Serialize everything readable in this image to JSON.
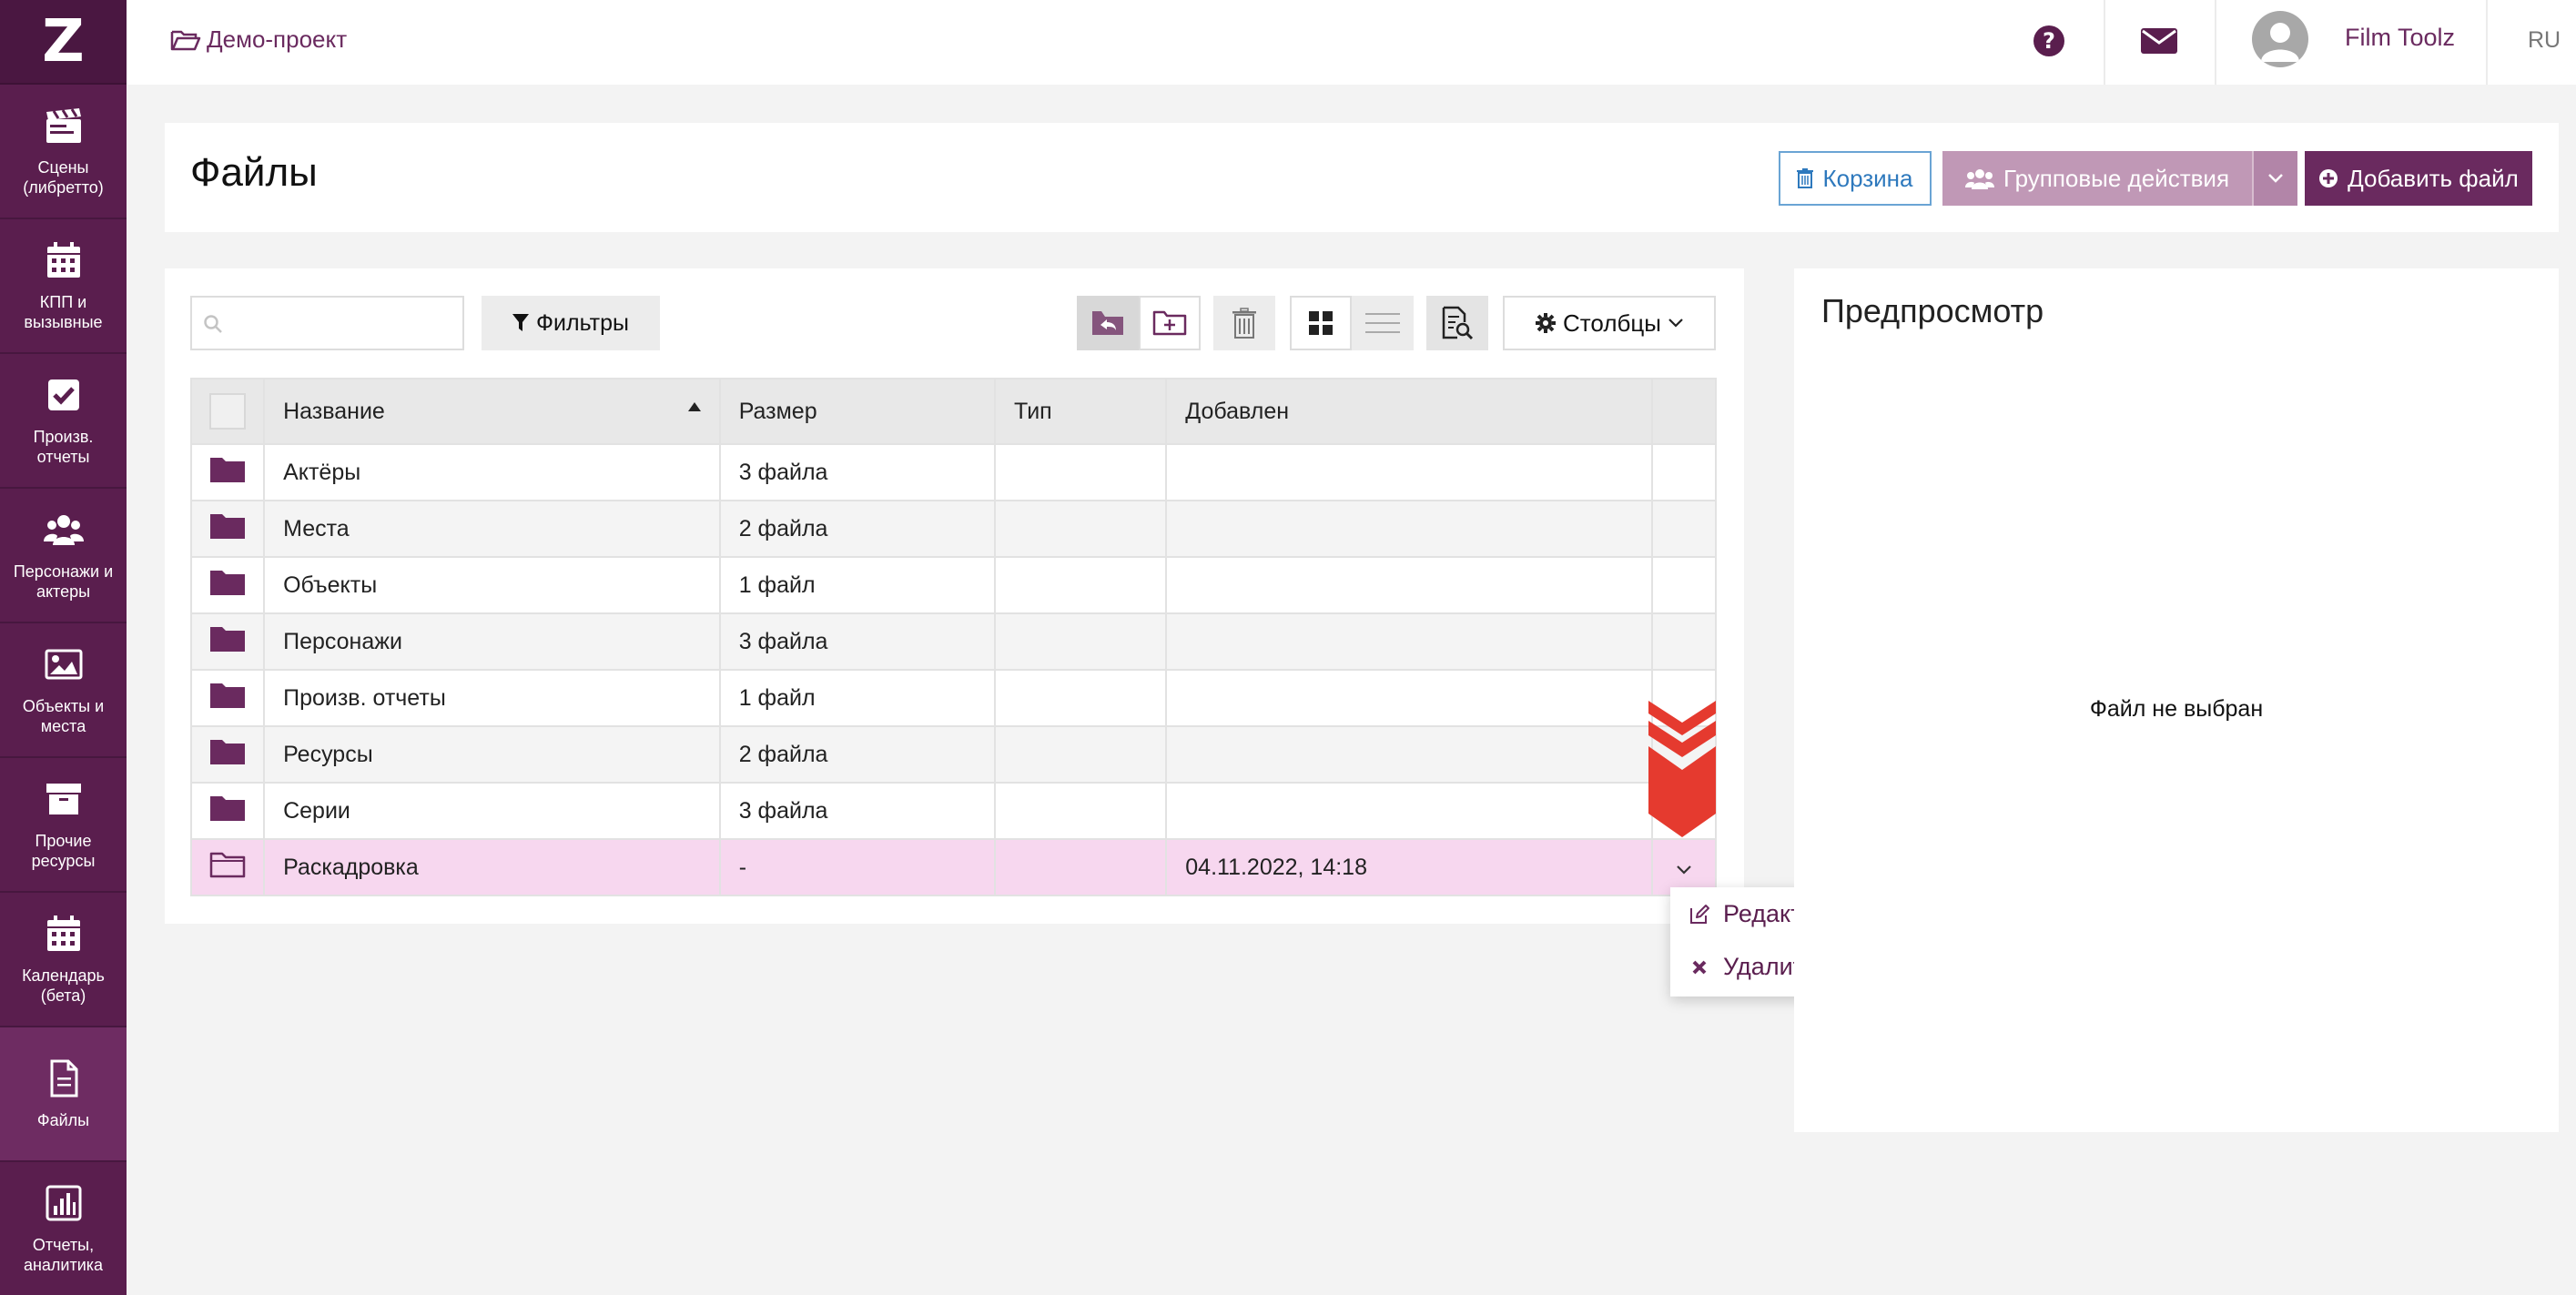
{
  "sidebar": {
    "logo": "Z",
    "items": [
      {
        "label": "Сцены (либретто)",
        "icon": "clapperboard-icon"
      },
      {
        "label": "КПП и вызывные",
        "icon": "calendar-icon"
      },
      {
        "label": "Произв. отчеты",
        "icon": "checkbox-icon"
      },
      {
        "label": "Персонажи и актеры",
        "icon": "users-icon"
      },
      {
        "label": "Объекты и места",
        "icon": "image-icon"
      },
      {
        "label": "Прочие ресурсы",
        "icon": "archive-icon"
      },
      {
        "label": "Календарь (бета)",
        "icon": "calendar-icon"
      },
      {
        "label": "Файлы",
        "icon": "file-icon",
        "active": true
      },
      {
        "label": "Отчеты, аналитика",
        "icon": "bar-chart-icon"
      }
    ]
  },
  "topbar": {
    "project": "Демо-проект",
    "user_name": "Film Toolz",
    "language": "RU"
  },
  "header": {
    "title": "Файлы",
    "trash_label": "Корзина",
    "group_actions_label": "Групповые действия",
    "add_file_label": "Добавить файл"
  },
  "toolbar": {
    "search_placeholder": "",
    "filters_label": "Фильтры",
    "columns_label": "Столбцы"
  },
  "table": {
    "columns": [
      "Название",
      "Размер",
      "Тип",
      "Добавлен"
    ],
    "rows": [
      {
        "name": "Актёры",
        "size": "3 файла",
        "type": "",
        "added": ""
      },
      {
        "name": "Места",
        "size": "2 файла",
        "type": "",
        "added": ""
      },
      {
        "name": "Объекты",
        "size": "1 файл",
        "type": "",
        "added": ""
      },
      {
        "name": "Персонажи",
        "size": "3 файла",
        "type": "",
        "added": ""
      },
      {
        "name": "Произв. отчеты",
        "size": "1 файл",
        "type": "",
        "added": ""
      },
      {
        "name": "Ресурсы",
        "size": "2 файла",
        "type": "",
        "added": ""
      },
      {
        "name": "Серии",
        "size": "3 файла",
        "type": "",
        "added": ""
      },
      {
        "name": "Раскадровка",
        "size": "-",
        "type": "",
        "added": "04.11.2022, 14:18"
      }
    ]
  },
  "row_menu": {
    "edit_label": "Редактировать",
    "delete_label": "Удалить"
  },
  "preview": {
    "title": "Предпросмотр",
    "empty_text": "Файл не выбран"
  },
  "colors": {
    "brand": "#6a2a5f",
    "sidebar": "#5a1e4e",
    "selected_row": "#f7d7ef",
    "arrow": "#e53a2f"
  }
}
